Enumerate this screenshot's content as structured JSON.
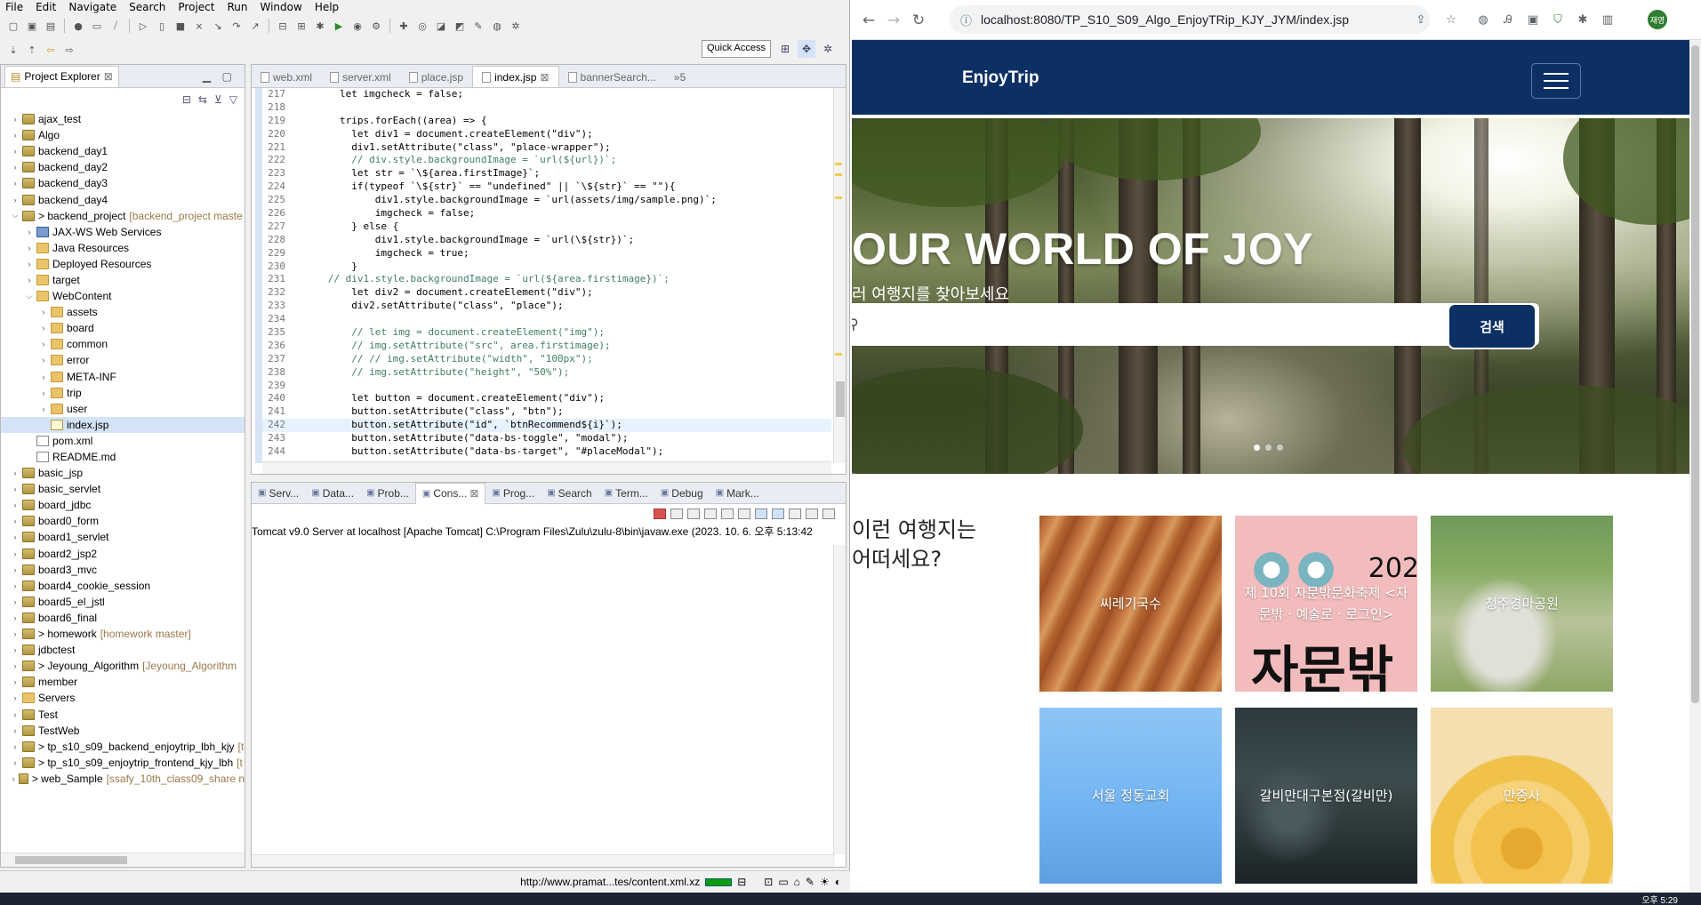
{
  "eclipse": {
    "menu": [
      "File",
      "Edit",
      "Navigate",
      "Search",
      "Project",
      "Run",
      "Window",
      "Help"
    ],
    "quick_access": "Quick Access",
    "project_explorer": {
      "title": "Project Explorer",
      "items": [
        {
          "label": "ajax_test",
          "level": 0,
          "icon": "proj",
          "open": false
        },
        {
          "label": "Algo",
          "level": 0,
          "icon": "proj",
          "open": false
        },
        {
          "label": "backend_day1",
          "level": 0,
          "icon": "proj",
          "open": false
        },
        {
          "label": "backend_day2",
          "level": 0,
          "icon": "proj",
          "open": false
        },
        {
          "label": "backend_day3",
          "level": 0,
          "icon": "proj",
          "open": false
        },
        {
          "label": "backend_day4",
          "level": 0,
          "icon": "proj",
          "open": false
        },
        {
          "label": "> backend_project",
          "suffix": "[backend_project maste",
          "level": 0,
          "icon": "proj",
          "open": true
        },
        {
          "label": "JAX-WS Web Services",
          "level": 1,
          "icon": "srv",
          "open": false
        },
        {
          "label": "Java Resources",
          "level": 1,
          "icon": "fold",
          "open": false
        },
        {
          "label": "Deployed Resources",
          "level": 1,
          "icon": "fold",
          "open": false
        },
        {
          "label": "target",
          "level": 1,
          "icon": "fold",
          "open": false
        },
        {
          "label": "WebContent",
          "level": 1,
          "icon": "fold",
          "open": true
        },
        {
          "label": "assets",
          "level": 2,
          "icon": "fold",
          "open": false
        },
        {
          "label": "board",
          "level": 2,
          "icon": "fold",
          "open": false
        },
        {
          "label": "common",
          "level": 2,
          "icon": "fold",
          "open": false
        },
        {
          "label": "error",
          "level": 2,
          "icon": "fold",
          "open": false
        },
        {
          "label": "META-INF",
          "level": 2,
          "icon": "fold",
          "open": false
        },
        {
          "label": "trip",
          "level": 2,
          "icon": "fold",
          "open": false
        },
        {
          "label": "user",
          "level": 2,
          "icon": "fold",
          "open": false
        },
        {
          "label": "index.jsp",
          "level": 2,
          "icon": "jsf",
          "open": null,
          "selected": true
        },
        {
          "label": "pom.xml",
          "level": 1,
          "icon": "file",
          "open": null
        },
        {
          "label": "README.md",
          "level": 1,
          "icon": "file",
          "open": null
        },
        {
          "label": "basic_jsp",
          "level": 0,
          "icon": "proj",
          "open": false
        },
        {
          "label": "basic_servlet",
          "level": 0,
          "icon": "proj",
          "open": false
        },
        {
          "label": "board_jdbc",
          "level": 0,
          "icon": "proj",
          "open": false
        },
        {
          "label": "board0_form",
          "level": 0,
          "icon": "proj",
          "open": false
        },
        {
          "label": "board1_servlet",
          "level": 0,
          "icon": "proj",
          "open": false
        },
        {
          "label": "board2_jsp2",
          "level": 0,
          "icon": "proj",
          "open": false
        },
        {
          "label": "board3_mvc",
          "level": 0,
          "icon": "proj",
          "open": false
        },
        {
          "label": "board4_cookie_session",
          "level": 0,
          "icon": "proj",
          "open": false
        },
        {
          "label": "board5_el_jstl",
          "level": 0,
          "icon": "proj",
          "open": false
        },
        {
          "label": "board6_final",
          "level": 0,
          "icon": "proj",
          "open": false
        },
        {
          "label": "> homework",
          "suffix": "[homework master]",
          "level": 0,
          "icon": "proj",
          "open": false
        },
        {
          "label": "jdbctest",
          "level": 0,
          "icon": "proj",
          "open": false
        },
        {
          "label": "> Jeyoung_Algorithm",
          "suffix": "[Jeyoung_Algorithm",
          "level": 0,
          "icon": "proj",
          "open": false
        },
        {
          "label": "member",
          "level": 0,
          "icon": "proj",
          "open": false
        },
        {
          "label": "Servers",
          "level": 0,
          "icon": "fold",
          "open": false
        },
        {
          "label": "Test",
          "level": 0,
          "icon": "proj",
          "open": false
        },
        {
          "label": "TestWeb",
          "level": 0,
          "icon": "proj",
          "open": false
        },
        {
          "label": "> tp_s10_s09_backend_enjoytrip_lbh_kjy",
          "suffix": "[t",
          "level": 0,
          "icon": "proj",
          "open": false
        },
        {
          "label": "> tp_s10_s09_enjoytrip_frontend_kjy_lbh",
          "suffix": "[t",
          "level": 0,
          "icon": "proj",
          "open": false
        },
        {
          "label": "> web_Sample",
          "suffix": "[ssafy_10th_class09_share n",
          "level": 0,
          "icon": "proj",
          "open": false
        }
      ]
    },
    "editor": {
      "tabs": [
        {
          "label": "web.xml",
          "active": false
        },
        {
          "label": "server.xml",
          "active": false
        },
        {
          "label": "place.jsp",
          "active": false
        },
        {
          "label": "index.jsp",
          "active": true
        },
        {
          "label": "bannerSearch...",
          "active": false
        },
        {
          "label": "»5",
          "active": false
        }
      ],
      "lines": [
        {
          "n": "217",
          "t": "        let imgcheck = false;"
        },
        {
          "n": "218",
          "t": ""
        },
        {
          "n": "219",
          "t": "        trips.forEach((area) => {"
        },
        {
          "n": "220",
          "t": "          let div1 = document.createElement(\"div\");"
        },
        {
          "n": "221",
          "t": "          div1.setAttribute(\"class\", \"place-wrapper\");"
        },
        {
          "n": "222",
          "t": "          // div.style.backgroundImage = `url(${url})`;"
        },
        {
          "n": "223",
          "t": "          let str = `\\${area.firstImage}`;"
        },
        {
          "n": "224",
          "t": "          if(typeof `\\${str}` == \"undefined\" || `\\${str}` == \"\"){"
        },
        {
          "n": "225",
          "t": "              div1.style.backgroundImage = `url(assets/img/sample.png)`;"
        },
        {
          "n": "226",
          "t": "              imgcheck = false;"
        },
        {
          "n": "227",
          "t": "          } else {"
        },
        {
          "n": "228",
          "t": "              div1.style.backgroundImage = `url(\\${str})`;"
        },
        {
          "n": "229",
          "t": "              imgcheck = true;"
        },
        {
          "n": "230",
          "t": "          }"
        },
        {
          "n": "231",
          "t": "      // div1.style.backgroundImage = `url(${area.firstimage})`;"
        },
        {
          "n": "232",
          "t": "          let div2 = document.createElement(\"div\");"
        },
        {
          "n": "233",
          "t": "          div2.setAttribute(\"class\", \"place\");"
        },
        {
          "n": "234",
          "t": ""
        },
        {
          "n": "235",
          "t": "          // let img = document.createElement(\"img\");"
        },
        {
          "n": "236",
          "t": "          // img.setAttribute(\"src\", area.firstimage);"
        },
        {
          "n": "237",
          "t": "          // // img.setAttribute(\"width\", \"100px\");"
        },
        {
          "n": "238",
          "t": "          // img.setAttribute(\"height\", \"50%\");"
        },
        {
          "n": "239",
          "t": ""
        },
        {
          "n": "240",
          "t": "          let button = document.createElement(\"div\");"
        },
        {
          "n": "241",
          "t": "          button.setAttribute(\"class\", \"btn\");"
        },
        {
          "n": "242",
          "t": "          button.setAttribute(\"id\", `btnRecommend${i}`);"
        },
        {
          "n": "243",
          "t": "          button.setAttribute(\"data-bs-toggle\", \"modal\");"
        },
        {
          "n": "244",
          "t": "          button.setAttribute(\"data-bs-target\", \"#placeModal\");"
        }
      ]
    },
    "console": {
      "tabs": [
        {
          "label": "Serv...",
          "active": false
        },
        {
          "label": "Data...",
          "active": false
        },
        {
          "label": "Prob...",
          "active": false
        },
        {
          "label": "Cons...",
          "active": true
        },
        {
          "label": "Prog...",
          "active": false
        },
        {
          "label": "Search",
          "active": false
        },
        {
          "label": "Term...",
          "active": false
        },
        {
          "label": "Debug",
          "active": false
        },
        {
          "label": "Mark...",
          "active": false
        }
      ],
      "status": "Tomcat v9.0 Server at localhost [Apache Tomcat] C:\\Program Files\\Zulu\\zulu-8\\bin\\javaw.exe (2023. 10. 6. 오후 5:13:42"
    },
    "statusbar": {
      "text": "http://www.pramat...tes/content.xml.xz"
    }
  },
  "browser": {
    "url": "localhost:8080/TP_S10_S09_Algo_EnjoyTRip_KJY_JYM/index.jsp",
    "profile": "재영",
    "site": {
      "brand": "EnjoyTrip",
      "hero_title": "OUR WORLD OF JOY",
      "hero_subtitle": "러 여행지를 찾아보세요",
      "search_placeholder": "",
      "search_button": "검색",
      "rec_title": "이런 여행지는 어떠세요?",
      "cards": [
        {
          "label": "씨레기국수"
        },
        {
          "label": "제 10회 자문밖문화축제 <자문밖 · 예술로 · 로그인>",
          "big": "자문밖",
          "year": "202"
        },
        {
          "label": "청주경마공원"
        },
        {
          "label": "서울 정동교회"
        },
        {
          "label": "갈비만대구본점(갈비만)"
        },
        {
          "label": "만중사"
        }
      ]
    }
  },
  "taskbar": {
    "clock": "오후 5:29"
  }
}
